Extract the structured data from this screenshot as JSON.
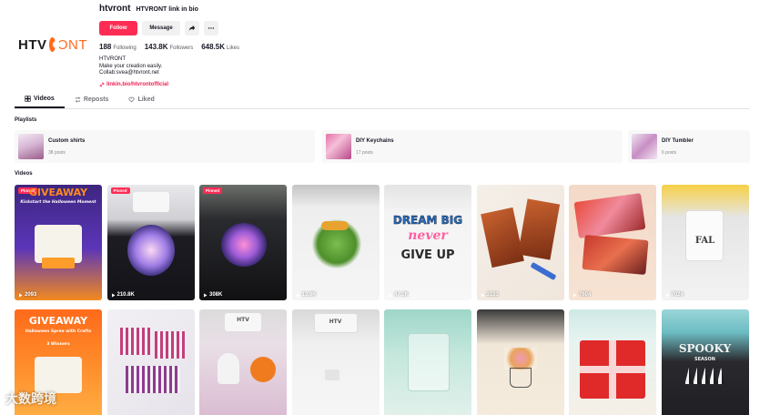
{
  "logo": {
    "part1": "HTV",
    "part2": "ONT"
  },
  "profile": {
    "username": "htvront",
    "nickname": "HTVRONT link in bio",
    "follow_label": "Follow",
    "message_label": "Message",
    "share_icon": "share-icon",
    "more_icon": "more-icon",
    "stats": [
      {
        "value": "188",
        "label": "Following"
      },
      {
        "value": "143.8K",
        "label": "Followers"
      },
      {
        "value": "648.5K",
        "label": "Likes"
      }
    ],
    "bio": [
      "HTVRONT",
      "Make your creation easily.",
      "Collab:svea@htvront.net"
    ],
    "link": "linkin.bio/htvrontofficial"
  },
  "tabs": [
    {
      "label": "Videos",
      "icon": "grid-icon"
    },
    {
      "label": "Reposts",
      "icon": "repost-icon"
    },
    {
      "label": "Liked",
      "icon": "heart-icon"
    }
  ],
  "sections": {
    "playlists": "Playlists",
    "videos": "Videos"
  },
  "playlists": [
    {
      "title": "Custom shirts",
      "count": "38 posts"
    },
    {
      "title": "DIY Keychains",
      "count": "17 posts"
    },
    {
      "title": "DIY Tumbler",
      "count": "6 posts"
    }
  ],
  "videos": [
    {
      "views": "2093",
      "badge": "Pinned",
      "text": "GIVEAWAY",
      "sub": "Kickstart the Halloween Moment"
    },
    {
      "views": "210.8K",
      "badge": "Pinned"
    },
    {
      "views": "308K",
      "badge": "Pinned"
    },
    {
      "views": "13.9K"
    },
    {
      "views": "47.2K",
      "text": "DREAM BIG",
      "text2": "never",
      "text3": "GIVE UP"
    },
    {
      "views": "3133"
    },
    {
      "views": "7604"
    },
    {
      "views": "7024",
      "text": "FAL"
    },
    {
      "text": "GIVEAWAY",
      "sub": "Halloween Spree with Crafts",
      "sub2": "3 Winners"
    },
    {},
    {
      "text": "HTV"
    },
    {
      "text": "HTV"
    },
    {},
    {},
    {},
    {
      "text": "SPOOKY",
      "sub": "SEASON"
    }
  ],
  "watermark": "大数跨境",
  "colors": {
    "accent": "#fe2c55",
    "brand": "#ff6a1a",
    "link": "#ee1d52"
  }
}
